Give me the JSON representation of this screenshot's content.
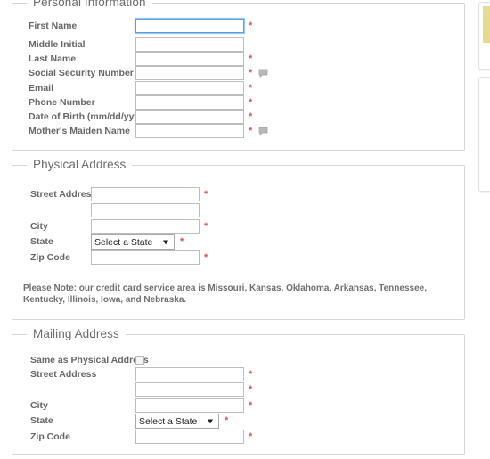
{
  "sections": [
    {
      "id": "personal",
      "legend": "Personal Information",
      "fields": [
        {
          "label": "First Name",
          "value": "",
          "required": true,
          "help": false,
          "focused": true
        },
        {
          "label": "Middle Initial",
          "value": "",
          "required": false,
          "help": false,
          "focused": false
        },
        {
          "label": "Last Name",
          "value": "",
          "required": true,
          "help": false,
          "focused": false
        },
        {
          "label": "Social Security Number",
          "value": "",
          "required": true,
          "help": true,
          "focused": false
        },
        {
          "label": "Email",
          "value": "",
          "required": true,
          "help": false,
          "focused": false
        },
        {
          "label": "Phone Number",
          "value": "",
          "required": true,
          "help": false,
          "focused": false
        },
        {
          "label": "Date of Birth (mm/dd/yyyy)",
          "value": "",
          "required": true,
          "help": false,
          "focused": false
        },
        {
          "label": "Mother's Maiden Name",
          "value": "",
          "required": true,
          "help": true,
          "focused": false
        }
      ]
    },
    {
      "id": "physical",
      "legend": "Physical Address",
      "fields": [
        {
          "label": "Street Address",
          "value": "",
          "required": true,
          "help": false,
          "focused": false
        },
        {
          "label": "",
          "value": "",
          "required": false,
          "help": false,
          "focused": false
        },
        {
          "label": "City",
          "value": "",
          "required": true,
          "help": false,
          "focused": false
        },
        {
          "label": "Zip Code",
          "value": "",
          "required": true,
          "help": false,
          "focused": false
        }
      ],
      "state_label": "State",
      "state_value": "Select a State",
      "state_required": true,
      "note": "Please Note: our credit card service area is Missouri, Kansas, Oklahoma, Arkansas, Tennessee, Kentucky, Illinois, Iowa, and Nebraska."
    },
    {
      "id": "mailing",
      "legend": "Mailing Address",
      "same_as_label": "Same as Physical Address",
      "same_as_checked": false,
      "fields": [
        {
          "label": "Street Address",
          "value": "",
          "required": true,
          "help": false,
          "focused": false
        },
        {
          "label": "",
          "value": "",
          "required": true,
          "help": false,
          "focused": false
        },
        {
          "label": "City",
          "value": "",
          "required": true,
          "help": false,
          "focused": false
        },
        {
          "label": "Zip Code",
          "value": "",
          "required": true,
          "help": false,
          "focused": false
        }
      ],
      "state_label": "State",
      "state_value": "Select a State",
      "state_required": true
    }
  ],
  "markers": {
    "required_glyph": "*",
    "help_icon_name": "help-bubble-icon"
  },
  "colors": {
    "required_red": "#d9534f",
    "legend_gray": "#6b6b6b",
    "label_gray": "#666666",
    "border_gray": "#d6d6d6",
    "input_border": "#bdbdbd",
    "focus_blue": "#5a9fe0"
  },
  "edge_cards": [
    {
      "name": "thumbnail-card-yellow"
    },
    {
      "name": "thumbnail-card-beach"
    }
  ]
}
